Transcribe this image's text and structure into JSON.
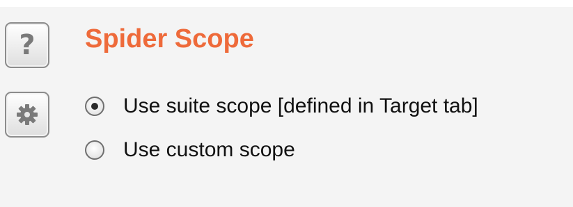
{
  "section": {
    "title": "Spider Scope",
    "title_color": "#ee6a3a"
  },
  "side_buttons": {
    "help": {
      "icon": "question-mark-icon",
      "glyph": "?"
    },
    "settings": {
      "icon": "gear-icon"
    }
  },
  "scope_options": [
    {
      "label": "Use suite scope [defined in Target tab]",
      "selected": true
    },
    {
      "label": "Use custom scope",
      "selected": false
    }
  ]
}
